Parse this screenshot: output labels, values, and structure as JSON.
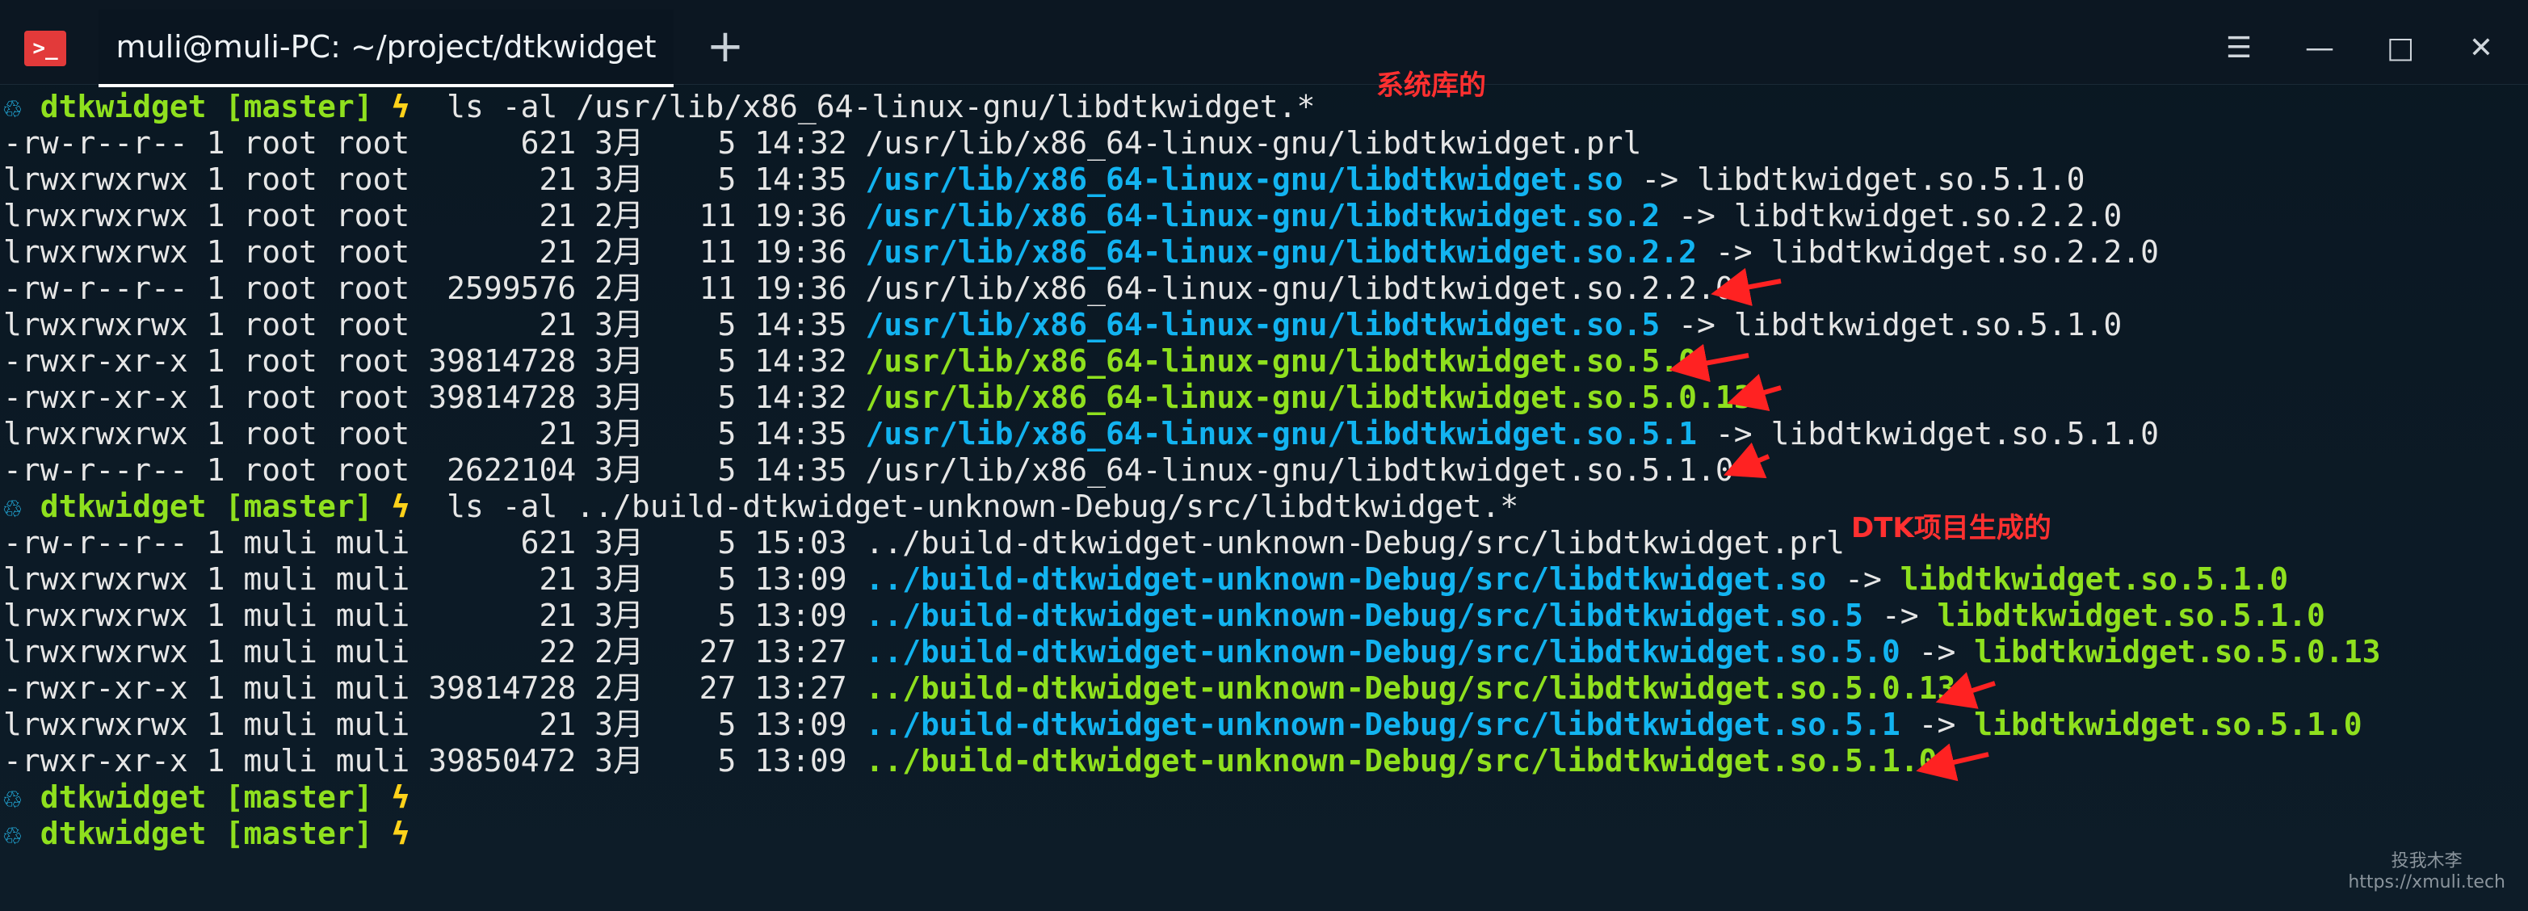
{
  "window": {
    "title": "muli@muli-PC: ~/project/dtkwidget",
    "new_tab_symbol": "+",
    "app_icon_glyph": ">_",
    "controls": {
      "menu": "☰",
      "minimize": "—",
      "maximize": "□",
      "close": "✕"
    }
  },
  "prompt": {
    "icon": "♲",
    "dir": "dtkwidget",
    "branch": "[master]",
    "bolt": "ϟ"
  },
  "commands": [
    "ls -al /usr/lib/x86_64-linux-gnu/libdtkwidget.*",
    "ls -al ../build-dtkwidget-unknown-Debug/src/libdtkwidget.*"
  ],
  "system_listing": [
    {
      "meta": "-rw-r--r-- 1 root root      621 3月    5 14:32",
      "path": "/usr/lib/x86_64-linux-gnu/libdtkwidget.prl",
      "path_type": "plain",
      "target": ""
    },
    {
      "meta": "lrwxrwxrwx 1 root root       21 3月    5 14:35",
      "path": "/usr/lib/x86_64-linux-gnu/libdtkwidget.so",
      "path_type": "link",
      "target": "libdtkwidget.so.5.1.0"
    },
    {
      "meta": "lrwxrwxrwx 1 root root       21 2月   11 19:36",
      "path": "/usr/lib/x86_64-linux-gnu/libdtkwidget.so.2",
      "path_type": "link",
      "target": "libdtkwidget.so.2.2.0"
    },
    {
      "meta": "lrwxrwxrwx 1 root root       21 2月   11 19:36",
      "path": "/usr/lib/x86_64-linux-gnu/libdtkwidget.so.2.2",
      "path_type": "link",
      "target": "libdtkwidget.so.2.2.0"
    },
    {
      "meta": "-rw-r--r-- 1 root root  2599576 2月   11 19:36",
      "path": "/usr/lib/x86_64-linux-gnu/libdtkwidget.so.2.2.0",
      "path_type": "plain",
      "target": ""
    },
    {
      "meta": "lrwxrwxrwx 1 root root       21 3月    5 14:35",
      "path": "/usr/lib/x86_64-linux-gnu/libdtkwidget.so.5",
      "path_type": "link",
      "target": "libdtkwidget.so.5.1.0"
    },
    {
      "meta": "-rwxr-xr-x 1 root root 39814728 3月    5 14:32",
      "path": "/usr/lib/x86_64-linux-gnu/libdtkwidget.so.5.0",
      "path_type": "exec",
      "target": ""
    },
    {
      "meta": "-rwxr-xr-x 1 root root 39814728 3月    5 14:32",
      "path": "/usr/lib/x86_64-linux-gnu/libdtkwidget.so.5.0.13",
      "path_type": "exec",
      "target": ""
    },
    {
      "meta": "lrwxrwxrwx 1 root root       21 3月    5 14:35",
      "path": "/usr/lib/x86_64-linux-gnu/libdtkwidget.so.5.1",
      "path_type": "link",
      "target": "libdtkwidget.so.5.1.0"
    },
    {
      "meta": "-rw-r--r-- 1 root root  2622104 3月    5 14:35",
      "path": "/usr/lib/x86_64-linux-gnu/libdtkwidget.so.5.1.0",
      "path_type": "plain",
      "target": ""
    }
  ],
  "build_listing": [
    {
      "meta": "-rw-r--r-- 1 muli muli      621 3月    5 15:03",
      "path": "../build-dtkwidget-unknown-Debug/src/libdtkwidget.prl",
      "path_type": "plain",
      "target": ""
    },
    {
      "meta": "lrwxrwxrwx 1 muli muli       21 3月    5 13:09",
      "path": "../build-dtkwidget-unknown-Debug/src/libdtkwidget.so",
      "path_type": "link",
      "target": "libdtkwidget.so.5.1.0"
    },
    {
      "meta": "lrwxrwxrwx 1 muli muli       21 3月    5 13:09",
      "path": "../build-dtkwidget-unknown-Debug/src/libdtkwidget.so.5",
      "path_type": "link",
      "target": "libdtkwidget.so.5.1.0"
    },
    {
      "meta": "lrwxrwxrwx 1 muli muli       22 2月   27 13:27",
      "path": "../build-dtkwidget-unknown-Debug/src/libdtkwidget.so.5.0",
      "path_type": "link",
      "target": "libdtkwidget.so.5.0.13"
    },
    {
      "meta": "-rwxr-xr-x 1 muli muli 39814728 2月   27 13:27",
      "path": "../build-dtkwidget-unknown-Debug/src/libdtkwidget.so.5.0.13",
      "path_type": "exec",
      "target": ""
    },
    {
      "meta": "lrwxrwxrwx 1 muli muli       21 3月    5 13:09",
      "path": "../build-dtkwidget-unknown-Debug/src/libdtkwidget.so.5.1",
      "path_type": "link",
      "target": "libdtkwidget.so.5.1.0"
    },
    {
      "meta": "-rwxr-xr-x 1 muli muli 39850472 3月    5 13:09",
      "path": "../build-dtkwidget-unknown-Debug/src/libdtkwidget.so.5.1.0",
      "path_type": "exec",
      "target": ""
    }
  ],
  "link_arrow": " -> ",
  "annotations": {
    "system_libs": "系统库的",
    "dtk_generated": "DTK项目生成的"
  },
  "watermark": {
    "line1": "投我木李",
    "line2": "https://xmuli.tech"
  },
  "colors": {
    "background": "#0b1a26",
    "link_path": "#12b3f0",
    "exec_path": "#8fe01e",
    "annotation": "#ff3030",
    "bolt": "#ffd21a"
  }
}
